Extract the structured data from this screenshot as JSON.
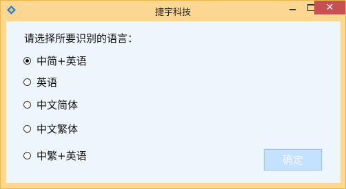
{
  "window": {
    "title": "捷宇科技",
    "icon": "app-diamond-icon",
    "close_glyph": "✕"
  },
  "prompt": "请选择所要识别的语言：",
  "options": [
    {
      "label": "中简+英语",
      "checked": true
    },
    {
      "label": "英语",
      "checked": false
    },
    {
      "label": "中文简体",
      "checked": false
    },
    {
      "label": "中文繁体",
      "checked": false
    },
    {
      "label": "中繁+英语",
      "checked": false
    }
  ],
  "ok_label": "确定",
  "colors": {
    "frame": "#fcd792",
    "client": "#eef6fd",
    "close": "#c75050",
    "button": "#c4e2ff"
  }
}
